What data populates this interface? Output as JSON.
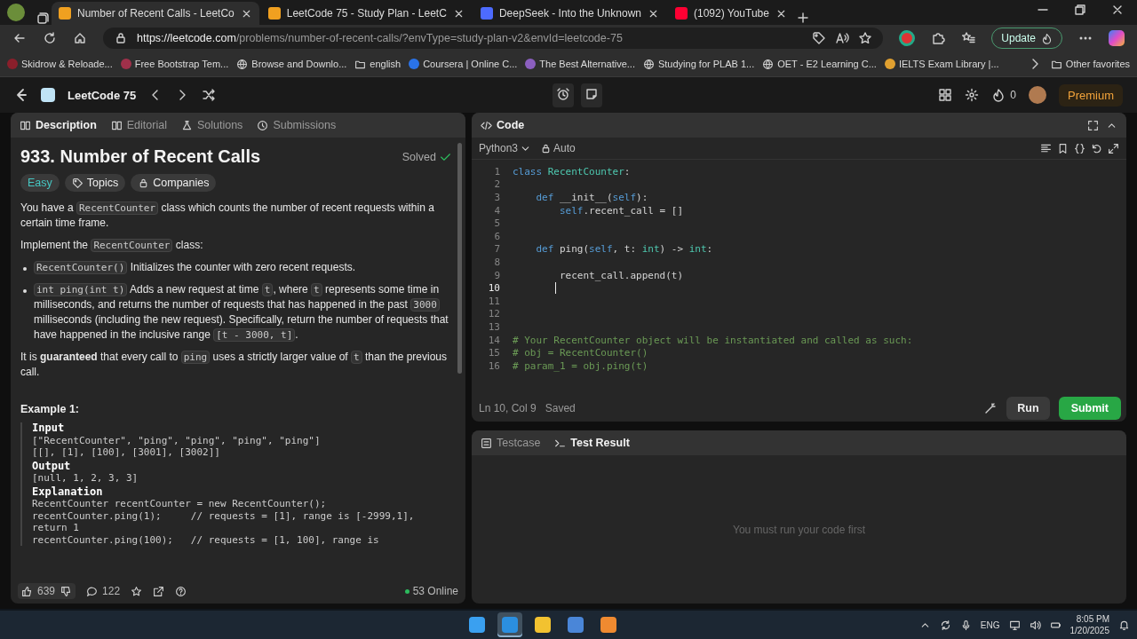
{
  "browser": {
    "tabs": [
      {
        "title": "Number of Recent Calls - LeetCo",
        "color": "#f0a020",
        "selected": true
      },
      {
        "title": "LeetCode 75 - Study Plan - LeetC",
        "color": "#f0a020",
        "selected": false
      },
      {
        "title": "DeepSeek - Into the Unknown",
        "color": "#4d6bfe",
        "selected": false
      },
      {
        "title": "(1092) YouTube",
        "color": "#ff0033",
        "selected": false
      }
    ],
    "url_host": "https://leetcode.com",
    "url_path": "/problems/number-of-recent-calls/?envType=study-plan-v2&envId=leetcode-75",
    "update_label": "Update",
    "bookmarks": [
      {
        "label": "Skidrow & Reloade...",
        "kind": "site",
        "color": "#8a1f2b"
      },
      {
        "label": "Free Bootstrap Tem...",
        "kind": "site",
        "color": "#a0304a"
      },
      {
        "label": "Browse and Downlo...",
        "kind": "globe"
      },
      {
        "label": "english",
        "kind": "folder"
      },
      {
        "label": "Coursera | Online C...",
        "kind": "site",
        "color": "#2a73e8"
      },
      {
        "label": "The Best Alternative...",
        "kind": "site",
        "color": "#8b5fbf"
      },
      {
        "label": "Studying for PLAB 1...",
        "kind": "globe"
      },
      {
        "label": "OET - E2 Learning C...",
        "kind": "globe"
      },
      {
        "label": "IELTS Exam Library |...",
        "kind": "site",
        "color": "#e0a030"
      }
    ],
    "other_favorites": "Other favorites"
  },
  "nav": {
    "title": "LeetCode 75",
    "streak": "0",
    "premium": "Premium"
  },
  "description": {
    "tabs": [
      {
        "label": "Description",
        "selected": true
      },
      {
        "label": "Editorial",
        "selected": false
      },
      {
        "label": "Solutions",
        "selected": false
      },
      {
        "label": "Submissions",
        "selected": false
      }
    ],
    "title": "933. Number of Recent Calls",
    "status": "Solved",
    "tags": [
      {
        "label": "Easy",
        "kind": "difficulty"
      },
      {
        "label": "Topics",
        "kind": "topics"
      },
      {
        "label": "Companies",
        "kind": "companies"
      }
    ],
    "paragraphs": [
      [
        {
          "text": "You have a ",
          "kind": "text"
        },
        {
          "text": "RecentCounter",
          "kind": "code"
        },
        {
          "text": " class which counts the number of recent requests within a certain time frame.",
          "kind": "text"
        }
      ],
      [
        {
          "text": "Implement the ",
          "kind": "text"
        },
        {
          "text": "RecentCounter",
          "kind": "code"
        },
        {
          "text": " class:",
          "kind": "text"
        }
      ]
    ],
    "bullets": [
      [
        {
          "text": "RecentCounter()",
          "kind": "code"
        },
        {
          "text": " Initializes the counter with zero recent requests.",
          "kind": "text"
        }
      ],
      [
        {
          "text": "int ping(int t)",
          "kind": "code"
        },
        {
          "text": " Adds a new request at time ",
          "kind": "text"
        },
        {
          "text": "t",
          "kind": "code"
        },
        {
          "text": ", where ",
          "kind": "text"
        },
        {
          "text": "t",
          "kind": "code"
        },
        {
          "text": " represents some time in milliseconds, and returns the number of requests that has happened in the past ",
          "kind": "text"
        },
        {
          "text": "3000",
          "kind": "code"
        },
        {
          "text": " milliseconds (including the new request). Specifically, return the number of requests that have happened in the inclusive range ",
          "kind": "text"
        },
        {
          "text": "[t - 3000, t]",
          "kind": "code"
        },
        {
          "text": ".",
          "kind": "text"
        }
      ]
    ],
    "closing": [
      {
        "text": "It is ",
        "kind": "text"
      },
      {
        "text": "guaranteed",
        "kind": "bold"
      },
      {
        "text": " that every call to ",
        "kind": "text"
      },
      {
        "text": "ping",
        "kind": "code"
      },
      {
        "text": " uses a strictly larger value of ",
        "kind": "text"
      },
      {
        "text": "t",
        "kind": "code"
      },
      {
        "text": " than the previous call.",
        "kind": "text"
      }
    ],
    "example_title": "Example 1:",
    "example_lines": [
      {
        "text": "Input",
        "kind": "label"
      },
      {
        "text": "[\"RecentCounter\", \"ping\", \"ping\", \"ping\", \"ping\"]",
        "kind": "code"
      },
      {
        "text": "[[], [1], [100], [3001], [3002]]",
        "kind": "code"
      },
      {
        "text": "Output",
        "kind": "label"
      },
      {
        "text": "[null, 1, 2, 3, 3]",
        "kind": "code"
      },
      {
        "text": "Explanation",
        "kind": "label"
      },
      {
        "text": "RecentCounter recentCounter = new RecentCounter();",
        "kind": "code"
      },
      {
        "text": "recentCounter.ping(1);     // requests = [1], range is [-2999,1],",
        "kind": "code"
      },
      {
        "text": "return 1",
        "kind": "code"
      },
      {
        "text": "recentCounter.ping(100);   // requests = [1, 100], range is",
        "kind": "code"
      }
    ],
    "likes": "639",
    "comments": "122",
    "online": "53 Online"
  },
  "code": {
    "title": "Code",
    "language": "Python3",
    "mode": "Auto",
    "lines": [
      {
        "number": "1",
        "selected": false,
        "segments": [
          {
            "text": "class ",
            "kind": "keyword"
          },
          {
            "text": "RecentCounter",
            "kind": "type"
          },
          {
            "text": ":",
            "kind": "plain"
          }
        ]
      },
      {
        "number": "2",
        "selected": false
      },
      {
        "number": "3",
        "selected": false,
        "segments": [
          {
            "text": "    def ",
            "kind": "keyword"
          },
          {
            "text": "__init__(",
            "kind": "plain"
          },
          {
            "text": "self",
            "kind": "keyword"
          },
          {
            "text": "):",
            "kind": "plain"
          }
        ]
      },
      {
        "number": "4",
        "selected": false,
        "segments": [
          {
            "text": "        self",
            "kind": "keyword"
          },
          {
            "text": ".recent_call = []",
            "kind": "plain"
          }
        ]
      },
      {
        "number": "5",
        "selected": false
      },
      {
        "number": "6",
        "selected": false
      },
      {
        "number": "7",
        "selected": false,
        "segments": [
          {
            "text": "    def ",
            "kind": "keyword"
          },
          {
            "text": "ping(",
            "kind": "plain"
          },
          {
            "text": "self",
            "kind": "keyword"
          },
          {
            "text": ", t: ",
            "kind": "plain"
          },
          {
            "text": "int",
            "kind": "type"
          },
          {
            "text": ") -> ",
            "kind": "plain"
          },
          {
            "text": "int",
            "kind": "type"
          },
          {
            "text": ":",
            "kind": "plain"
          }
        ]
      },
      {
        "number": "8",
        "selected": false
      },
      {
        "number": "9",
        "selected": false,
        "segments": [
          {
            "text": "        recent_call.append(t)",
            "kind": "plain"
          }
        ]
      },
      {
        "number": "10",
        "selected": true
      },
      {
        "number": "11",
        "selected": false
      },
      {
        "number": "12",
        "selected": false
      },
      {
        "number": "13",
        "selected": false
      },
      {
        "number": "14",
        "selected": false,
        "segments": [
          {
            "text": "# Your RecentCounter object will be instantiated and called as such:",
            "kind": "comment"
          }
        ]
      },
      {
        "number": "15",
        "selected": false,
        "segments": [
          {
            "text": "# obj = RecentCounter()",
            "kind": "comment"
          }
        ]
      },
      {
        "number": "16",
        "selected": false,
        "segments": [
          {
            "text": "# param_1 = obj.ping(t)",
            "kind": "comment"
          }
        ]
      }
    ],
    "position": "Ln 10, Col 9",
    "save_state": "Saved",
    "run_label": "Run",
    "submit_label": "Submit"
  },
  "result": {
    "tabs": [
      {
        "label": "Testcase",
        "selected": false
      },
      {
        "label": "Test Result",
        "selected": true
      }
    ],
    "message": "You must run your code first"
  },
  "taskbar": {
    "apps": [
      {
        "color": "#3aa0f0",
        "selected": false
      },
      {
        "color": "#2b8fe0",
        "selected": true
      },
      {
        "color": "#f2c230",
        "selected": false
      },
      {
        "color": "#4a86d8",
        "selected": false
      },
      {
        "color": "#f08a30",
        "selected": false
      }
    ],
    "language": "ENG",
    "time": "8:05 PM",
    "date": "1/20/2025"
  }
}
